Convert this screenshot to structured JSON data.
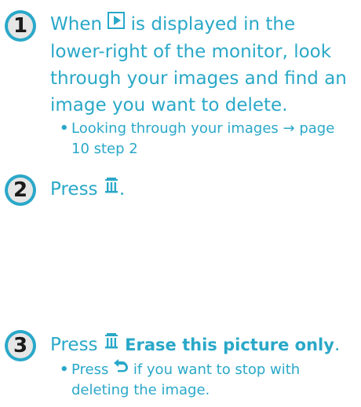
{
  "steps": [
    {
      "number": "1",
      "text_before_icon": "When",
      "icon": "play-mode-icon",
      "text_after_icon": "is displayed in the lower-right of the monitor, look through your images and find an image you want to delete.",
      "bullet": "Looking through your images → page 10 step 2"
    },
    {
      "number": "2",
      "text_before_icon": "Press",
      "icon": "trash-icon",
      "text_after_icon": "."
    },
    {
      "number": "3",
      "text_before_icon": "Press",
      "icon": "trash-icon",
      "bold_text": "Erase this picture only",
      "text_after_icon": ".",
      "bullet_before_icon": "Press",
      "bullet_icon": "return-icon",
      "bullet_after_icon": "if you want to stop with deleting the image."
    }
  ],
  "colors": {
    "accent": "#2aa8c8",
    "badge_fill": "#e7e6e6",
    "number_color": "#1b1b1b"
  }
}
